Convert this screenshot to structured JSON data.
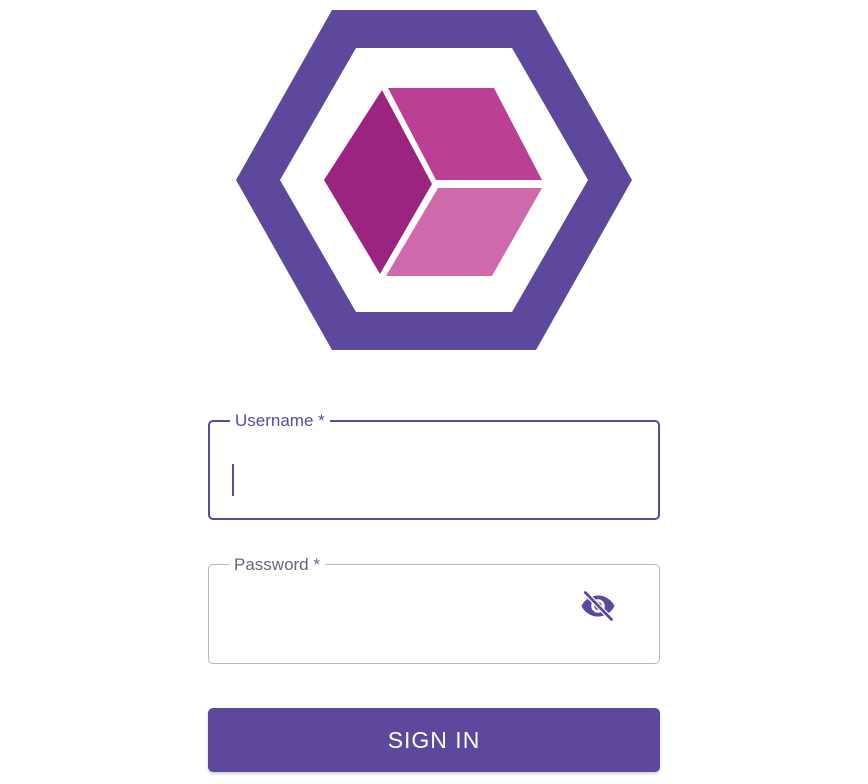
{
  "logo": {
    "icon": "hexagon-cube-logo",
    "colors": {
      "hexagon": "#5e489e",
      "cube_left": "#9a2480",
      "cube_top": "#bb3f95",
      "cube_right": "#ce6aab"
    }
  },
  "form": {
    "username": {
      "label": "Username *",
      "value": ""
    },
    "password": {
      "label": "Password *",
      "value": "",
      "toggle_icon": "eye-off-icon"
    },
    "submit_label": "SIGN IN"
  },
  "theme": {
    "accent": "#5e489e",
    "border_inactive": "#b9b5c6"
  }
}
